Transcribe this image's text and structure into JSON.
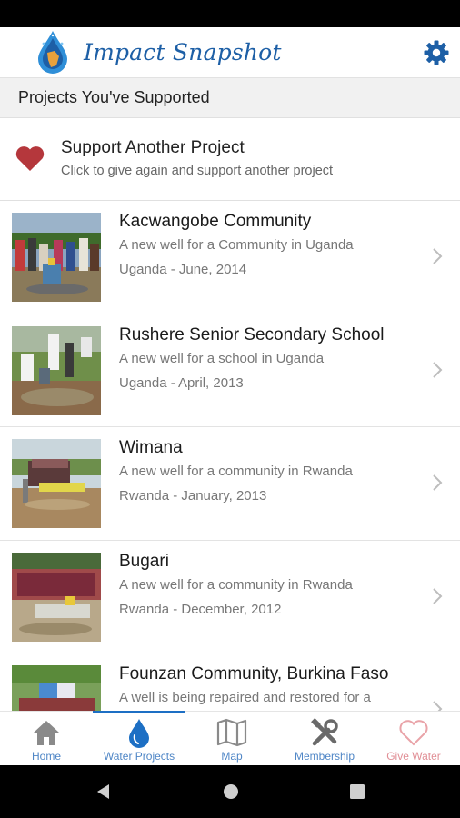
{
  "app": {
    "title": "Impact Snapshot"
  },
  "section": {
    "title": "Projects You've Supported"
  },
  "support": {
    "title": "Support Another Project",
    "subtitle": "Click to give again and support another project"
  },
  "projects": [
    {
      "name": "Kacwangobe Community",
      "description": "A new well for a Community in Uganda",
      "date": "Uganda - June, 2014"
    },
    {
      "name": "Rushere Senior Secondary School",
      "description": "A new well for a school in Uganda",
      "date": "Uganda - April, 2013"
    },
    {
      "name": "Wimana",
      "description": "A new well for a community in Rwanda",
      "date": "Rwanda - January, 2013"
    },
    {
      "name": "Bugari",
      "description": "A new well for a community in Rwanda",
      "date": "Rwanda - December, 2012"
    },
    {
      "name": "Founzan Community, Burkina Faso",
      "description": "A well is being repaired and restored for a",
      "date": ""
    }
  ],
  "nav": {
    "items": [
      {
        "label": "Home",
        "icon": "home-icon"
      },
      {
        "label": "Water Projects",
        "icon": "water-drop-icon"
      },
      {
        "label": "Map",
        "icon": "map-icon"
      },
      {
        "label": "Membership",
        "icon": "tools-icon"
      },
      {
        "label": "Give Water",
        "icon": "heart-outline-icon"
      }
    ],
    "active_index": 1
  },
  "colors": {
    "brand_blue": "#1d5fa6",
    "nav_label": "#4f86c6",
    "heart_red": "#b5373c",
    "give_water_pink": "#e9a3a8"
  }
}
